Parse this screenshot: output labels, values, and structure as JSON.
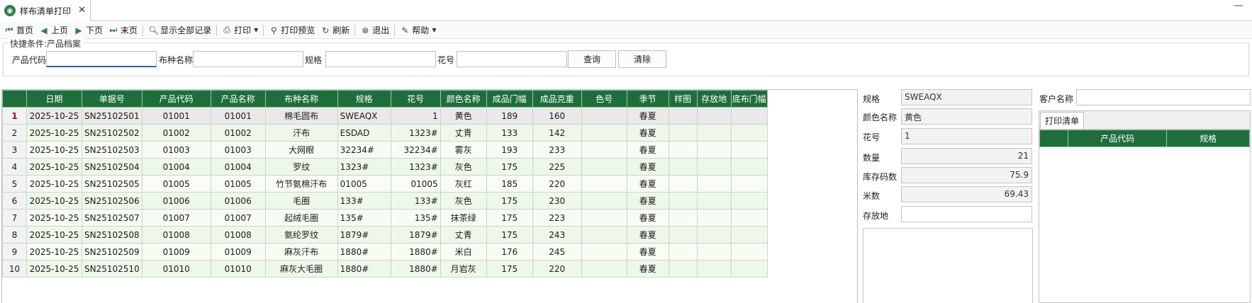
{
  "tab": {
    "title": "样布清单打印",
    "close": "✕"
  },
  "window": {
    "minimize": "—"
  },
  "toolbar": {
    "first": "首页",
    "prev": "上页",
    "next": "下页",
    "last": "末页",
    "show_all": "显示全部记录",
    "print": "打印",
    "print_preview": "打印预览",
    "refresh": "刷新",
    "exit": "退出",
    "help": "帮助"
  },
  "filter": {
    "legend": "快捷条件:产品档案",
    "product_code_label": "产品代码",
    "product_code_value": "",
    "fabric_name_label": "布种名称",
    "fabric_name_value": "",
    "spec_label": "规格",
    "spec_value": "",
    "pattern_label": "花号",
    "pattern_value": "",
    "query_button": "查询",
    "clear_button": "清除"
  },
  "grid": {
    "columns": [
      "日期",
      "单据号",
      "产品代码",
      "产品名称",
      "布种名称",
      "规格",
      "花号",
      "颜色名称",
      "成品门幅",
      "成品克重",
      "色号",
      "季节",
      "样图",
      "存放地",
      "底布门幅"
    ],
    "rows": [
      {
        "n": "1",
        "date": "2025-10-25",
        "doc": "SN25102501",
        "code": "01001",
        "pname": "01001",
        "fabric": "棉毛圆布",
        "spec": "SWEAQX",
        "pattern": "1",
        "color": "黄色",
        "width": "189",
        "weight": "160",
        "colorno": "",
        "season": "春夏",
        "image": "",
        "loc": "",
        "basewidth": ""
      },
      {
        "n": "2",
        "date": "2025-10-25",
        "doc": "SN25102502",
        "code": "01002",
        "pname": "01002",
        "fabric": "汗布",
        "spec": "ESDAD",
        "pattern": "1323#",
        "color": "丈青",
        "width": "133",
        "weight": "142",
        "colorno": "",
        "season": "春夏",
        "image": "",
        "loc": "",
        "basewidth": ""
      },
      {
        "n": "3",
        "date": "2025-10-25",
        "doc": "SN25102503",
        "code": "01003",
        "pname": "01003",
        "fabric": "大网眼",
        "spec": "32234#",
        "pattern": "32234#",
        "color": "雾灰",
        "width": "193",
        "weight": "233",
        "colorno": "",
        "season": "春夏",
        "image": "",
        "loc": "",
        "basewidth": ""
      },
      {
        "n": "4",
        "date": "2025-10-25",
        "doc": "SN25102504",
        "code": "01004",
        "pname": "01004",
        "fabric": "罗纹",
        "spec": "1323#",
        "pattern": "1323#",
        "color": "灰色",
        "width": "175",
        "weight": "225",
        "colorno": "",
        "season": "春夏",
        "image": "",
        "loc": "",
        "basewidth": ""
      },
      {
        "n": "5",
        "date": "2025-10-25",
        "doc": "SN25102505",
        "code": "01005",
        "pname": "01005",
        "fabric": "竹节氨棉汗布",
        "spec": "01005",
        "pattern": "01005",
        "color": "灰红",
        "width": "185",
        "weight": "220",
        "colorno": "",
        "season": "春夏",
        "image": "",
        "loc": "",
        "basewidth": ""
      },
      {
        "n": "6",
        "date": "2025-10-25",
        "doc": "SN25102506",
        "code": "01006",
        "pname": "01006",
        "fabric": "毛圈",
        "spec": "133#",
        "pattern": "133#",
        "color": "灰色",
        "width": "175",
        "weight": "230",
        "colorno": "",
        "season": "春夏",
        "image": "",
        "loc": "",
        "basewidth": ""
      },
      {
        "n": "7",
        "date": "2025-10-25",
        "doc": "SN25102507",
        "code": "01007",
        "pname": "01007",
        "fabric": "起绒毛圈",
        "spec": "135#",
        "pattern": "135#",
        "color": "抹茶绿",
        "width": "175",
        "weight": "223",
        "colorno": "",
        "season": "春夏",
        "image": "",
        "loc": "",
        "basewidth": ""
      },
      {
        "n": "8",
        "date": "2025-10-25",
        "doc": "SN25102508",
        "code": "01008",
        "pname": "01008",
        "fabric": "氨纶罗纹",
        "spec": "1879#",
        "pattern": "1879#",
        "color": "丈青",
        "width": "175",
        "weight": "243",
        "colorno": "",
        "season": "春夏",
        "image": "",
        "loc": "",
        "basewidth": ""
      },
      {
        "n": "9",
        "date": "2025-10-25",
        "doc": "SN25102509",
        "code": "01009",
        "pname": "01009",
        "fabric": "麻灰汗布",
        "spec": "1880#",
        "pattern": "1880#",
        "color": "米白",
        "width": "176",
        "weight": "245",
        "colorno": "",
        "season": "春夏",
        "image": "",
        "loc": "",
        "basewidth": ""
      },
      {
        "n": "10",
        "date": "2025-10-25",
        "doc": "SN25102510",
        "code": "01010",
        "pname": "01010",
        "fabric": "麻灰大毛圈",
        "spec": "1880#",
        "pattern": "1880#",
        "color": "月岩灰",
        "width": "175",
        "weight": "220",
        "colorno": "",
        "season": "春夏",
        "image": "",
        "loc": "",
        "basewidth": ""
      }
    ]
  },
  "detail": {
    "spec_label": "规格",
    "spec_value": "SWEAQX",
    "color_label": "颜色名称",
    "color_value": "黄色",
    "pattern_label": "花号",
    "pattern_value": "1",
    "qty_label": "数量",
    "qty_value": "21",
    "stock_label": "库存码数",
    "stock_value": "75.9",
    "meters_label": "米数",
    "meters_value": "69.43",
    "loc_label": "存放地",
    "loc_value": "",
    "customer_label": "客户名称",
    "customer_value": ""
  },
  "print_list": {
    "tab_label": "打印清单",
    "columns": [
      "产品代码",
      "规格"
    ]
  },
  "colors": {
    "header_green": "#1e6e3c",
    "row_green": "#eef8ea",
    "selected_row": "#e9e9e9",
    "selected_index": "#c00000"
  }
}
